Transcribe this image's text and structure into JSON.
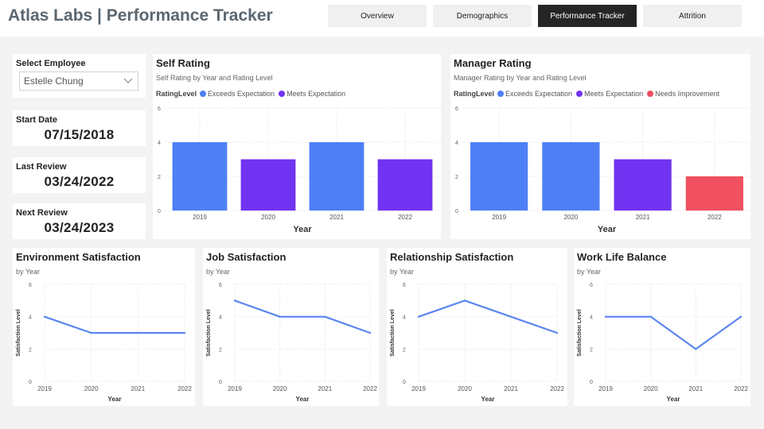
{
  "app_title": "Atlas Labs | Performance Tracker",
  "nav": [
    {
      "label": "Overview",
      "active": false
    },
    {
      "label": "Demographics",
      "active": false
    },
    {
      "label": "Performance Tracker",
      "active": true
    },
    {
      "label": "Attrition",
      "active": false
    }
  ],
  "employee": {
    "label": "Select Employee",
    "value": "Estelle Chung"
  },
  "dates": {
    "start_label": "Start Date",
    "start_value": "07/15/2018",
    "last_label": "Last Review",
    "last_value": "03/24/2022",
    "next_label": "Next Review",
    "next_value": "03/24/2023"
  },
  "legend_title": "RatingLevel",
  "colors": {
    "exceeds": "#4f7ff7",
    "meets": "#7133f2",
    "needs": "#f0505f",
    "line": "#5b86f0"
  },
  "chart_data": [
    {
      "type": "bar",
      "title": "Self Rating",
      "subtitle": "Self Rating by Year and Rating Level",
      "xlabel": "Year",
      "categories": [
        "2019",
        "2020",
        "2021",
        "2022"
      ],
      "values": [
        4,
        3,
        4,
        3
      ],
      "levels": [
        "Exceeds Expectation",
        "Meets Expectation",
        "Exceeds Expectation",
        "Meets Expectation"
      ],
      "legend": [
        "Exceeds Expectation",
        "Meets Expectation"
      ],
      "yticks": [
        "0",
        "2",
        "4",
        "6"
      ],
      "ylim": [
        0,
        6
      ],
      "grid": true
    },
    {
      "type": "bar",
      "title": "Manager Rating",
      "subtitle": "Manager Rating by Year and Rating Level",
      "xlabel": "Year",
      "categories": [
        "2019",
        "2020",
        "2021",
        "2022"
      ],
      "values": [
        4,
        4,
        3,
        2
      ],
      "levels": [
        "Exceeds Expectation",
        "Exceeds Expectation",
        "Meets Expectation",
        "Needs Improvement"
      ],
      "legend": [
        "Exceeds Expectation",
        "Meets Expectation",
        "Needs Improvement"
      ],
      "yticks": [
        "0",
        "2",
        "4",
        "6"
      ],
      "ylim": [
        0,
        6
      ],
      "grid": true
    },
    {
      "type": "line",
      "title": "Environment Satisfaction",
      "subtitle": "by Year",
      "xlabel": "Year",
      "ylabel": "Satisfaction Level",
      "categories": [
        "2019",
        "2020",
        "2021",
        "2022"
      ],
      "values": [
        4,
        3,
        3,
        3
      ],
      "yticks": [
        "0",
        "2",
        "4",
        "6"
      ],
      "ylim": [
        0,
        6
      ],
      "grid": true
    },
    {
      "type": "line",
      "title": "Job Satisfaction",
      "subtitle": "by Year",
      "xlabel": "Year",
      "ylabel": "Satisfaction Level",
      "categories": [
        "2019",
        "2020",
        "2021",
        "2022"
      ],
      "values": [
        5,
        4,
        4,
        3
      ],
      "yticks": [
        "0",
        "2",
        "4",
        "6"
      ],
      "ylim": [
        0,
        6
      ],
      "grid": true
    },
    {
      "type": "line",
      "title": "Relationship Satisfaction",
      "subtitle": "by Year",
      "xlabel": "Year",
      "ylabel": "Satisfaction Level",
      "categories": [
        "2019",
        "2020",
        "2021",
        "2022"
      ],
      "values": [
        4,
        5,
        4,
        3
      ],
      "yticks": [
        "0",
        "2",
        "4",
        "6"
      ],
      "ylim": [
        0,
        6
      ],
      "grid": true
    },
    {
      "type": "line",
      "title": "Work Life Balance",
      "subtitle": "by Year",
      "xlabel": "Year",
      "ylabel": "Satisfaction Level",
      "categories": [
        "2019",
        "2020",
        "2021",
        "2022"
      ],
      "values": [
        4,
        4,
        2,
        4
      ],
      "yticks": [
        "0",
        "2",
        "4",
        "6"
      ],
      "ylim": [
        0,
        6
      ],
      "grid": true
    }
  ]
}
